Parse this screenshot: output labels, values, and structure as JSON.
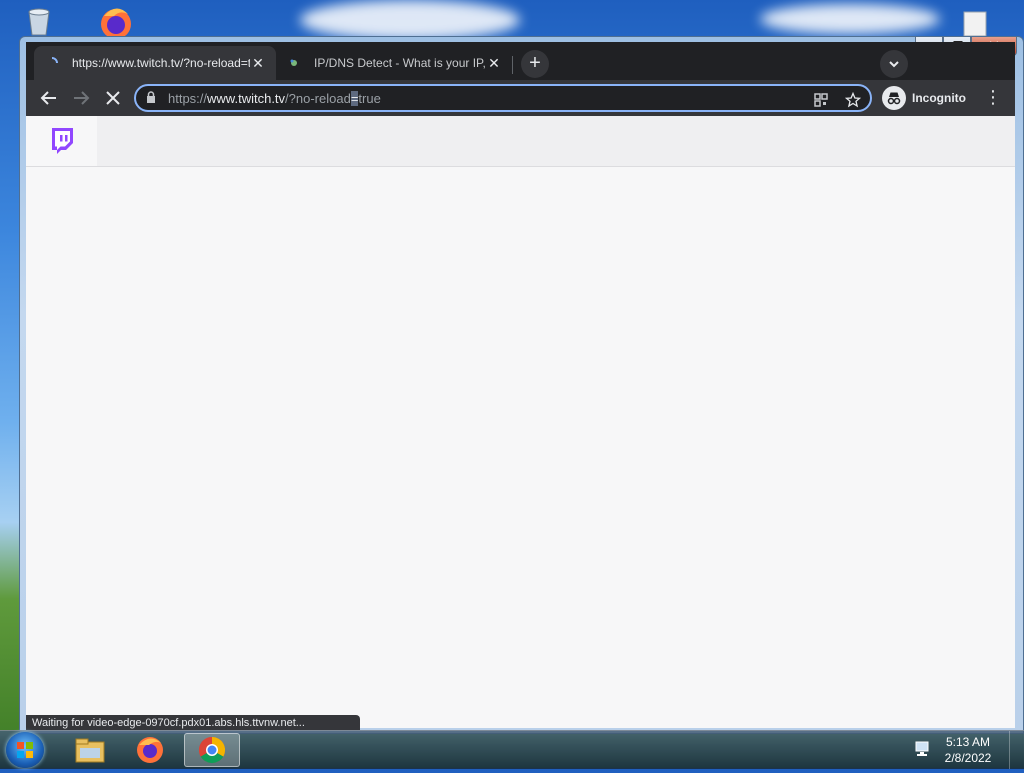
{
  "browser": {
    "tabs": [
      {
        "title": "https://www.twitch.tv/?no-reload=true",
        "active": true
      },
      {
        "title": "IP/DNS Detect - What is your IP, what is your DNS",
        "active": false
      }
    ],
    "omnibox": {
      "scheme": "https://",
      "host": "www.twitch.tv",
      "path_before_sel": "/?no-reload",
      "selected": "=",
      "path_after_sel": "true"
    },
    "profile_label": "Incognito"
  },
  "status_text": "Waiting for video-edge-0970cf.pdx01.abs.hls.ttvnw.net...",
  "taskbar": {
    "time": "5:13 AM",
    "date": "2/8/2022"
  },
  "colors": {
    "twitch_purple": "#9147ff",
    "omnibox_focus": "#8ab4f8"
  }
}
